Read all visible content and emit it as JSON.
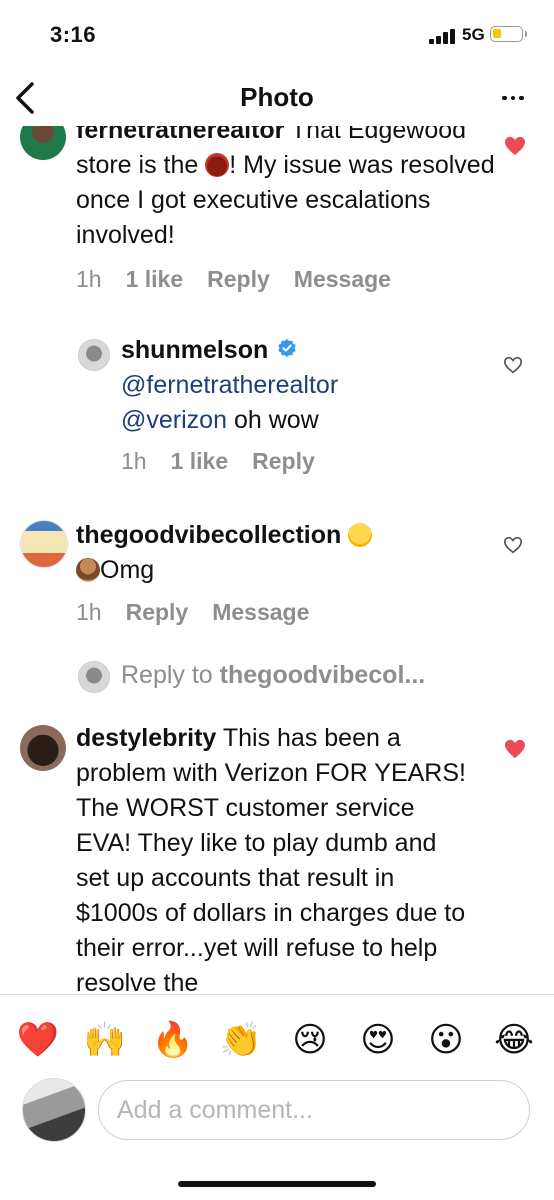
{
  "status_bar": {
    "time": "3:16",
    "network": "5G"
  },
  "header": {
    "title": "Photo"
  },
  "comments": [
    {
      "username": "fernetratherealtor",
      "text_a": "That Edgewood store is the",
      "text_b": "! My issue was resolved once I got executive escalations involved!",
      "emoji_name": "ogre-emoji",
      "time": "1h",
      "likes": "1 like",
      "reply": "Reply",
      "message": "Message",
      "liked": true
    },
    {
      "username": "shunmelson",
      "mention1": "@fernetratherealtor",
      "mention2": "@verizon",
      "text": "oh wow",
      "time": "1h",
      "likes": "1 like",
      "reply": "Reply",
      "verified": true,
      "liked": false
    },
    {
      "username": "thegoodvibecollection",
      "text": "Omg",
      "emoji_name": "weary-face-emoji",
      "time": "1h",
      "reply": "Reply",
      "message": "Message",
      "liked": false
    },
    {
      "username": "destylebrity",
      "text": "This has been a problem with Verizon FOR YEARS! The WORST customer service EVA! They like to play dumb and set up accounts that result in $1000s of dollars in charges due to their error...yet will refuse to help resolve the",
      "liked": true
    }
  ],
  "reply_prompt": {
    "prefix": "Reply to",
    "target": "thegoodvibecol..."
  },
  "emoji_bar": [
    "❤️",
    "🙌",
    "🔥",
    "👏",
    "😢",
    "😍",
    "😮",
    "😂"
  ],
  "composer": {
    "placeholder": "Add a comment..."
  },
  "colors": {
    "heart_liked": "#ed4956",
    "mention": "#1d3f7a",
    "meta": "#8e8e8e",
    "verified": "#3897f0"
  }
}
